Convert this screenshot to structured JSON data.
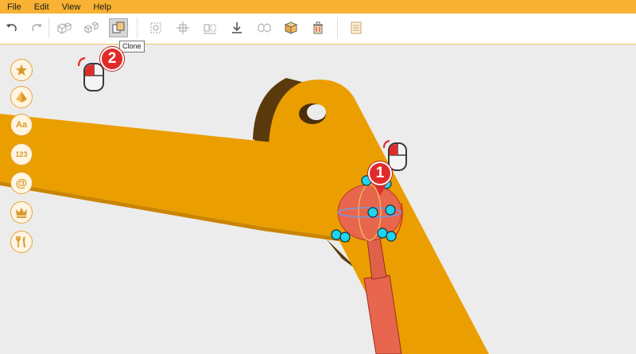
{
  "menu": {
    "items": [
      {
        "label": "File"
      },
      {
        "label": "Edit"
      },
      {
        "label": "View"
      },
      {
        "label": "Help"
      }
    ]
  },
  "toolbar": {
    "buttons": [
      {
        "icon": "undo-icon",
        "enabled": true
      },
      {
        "icon": "redo-icon",
        "enabled": false
      },
      {
        "icon": "group-icon",
        "enabled": false
      },
      {
        "icon": "ungroup-icon",
        "enabled": false
      },
      {
        "icon": "clone-icon",
        "enabled": true,
        "active": true
      },
      {
        "icon": "align-icon",
        "enabled": false
      },
      {
        "icon": "distribute-icon",
        "enabled": false
      },
      {
        "icon": "mirror-icon",
        "enabled": false
      },
      {
        "icon": "drop-to-floor-icon",
        "enabled": true
      },
      {
        "icon": "split-icon",
        "enabled": false
      },
      {
        "icon": "box-icon",
        "enabled": true
      },
      {
        "icon": "delete-icon",
        "enabled": true
      },
      {
        "icon": "notes-icon",
        "enabled": true
      }
    ],
    "tooltip": "Clone"
  },
  "sidebar": {
    "items": [
      {
        "icon": "star-icon"
      },
      {
        "icon": "shapes-pyramid-icon"
      },
      {
        "icon": "text-icon",
        "label": "Aa"
      },
      {
        "icon": "numbers-icon",
        "label": "123"
      },
      {
        "icon": "symbols-at-icon",
        "label": "@"
      },
      {
        "icon": "crown-icon"
      },
      {
        "icon": "tools-icon"
      }
    ]
  },
  "callouts": [
    {
      "number": "1",
      "action": "right-click"
    },
    {
      "number": "2",
      "action": "right-click"
    }
  ],
  "colors": {
    "menubar": "#f9b233",
    "model": "#eb9e00",
    "model_shadow": "#5a3a0c",
    "selection_handle": "#22d3ee",
    "cylinder": "#e8664d",
    "badge": "#e12b2b"
  }
}
